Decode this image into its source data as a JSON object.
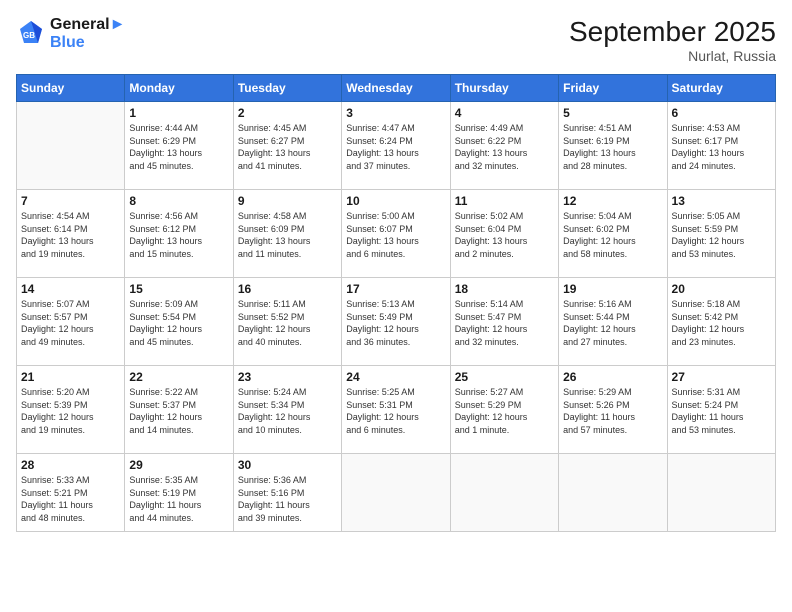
{
  "header": {
    "logo_line1": "General",
    "logo_line2": "Blue",
    "month": "September 2025",
    "location": "Nurlat, Russia"
  },
  "weekdays": [
    "Sunday",
    "Monday",
    "Tuesday",
    "Wednesday",
    "Thursday",
    "Friday",
    "Saturday"
  ],
  "weeks": [
    [
      {
        "day": "",
        "info": ""
      },
      {
        "day": "1",
        "info": "Sunrise: 4:44 AM\nSunset: 6:29 PM\nDaylight: 13 hours\nand 45 minutes."
      },
      {
        "day": "2",
        "info": "Sunrise: 4:45 AM\nSunset: 6:27 PM\nDaylight: 13 hours\nand 41 minutes."
      },
      {
        "day": "3",
        "info": "Sunrise: 4:47 AM\nSunset: 6:24 PM\nDaylight: 13 hours\nand 37 minutes."
      },
      {
        "day": "4",
        "info": "Sunrise: 4:49 AM\nSunset: 6:22 PM\nDaylight: 13 hours\nand 32 minutes."
      },
      {
        "day": "5",
        "info": "Sunrise: 4:51 AM\nSunset: 6:19 PM\nDaylight: 13 hours\nand 28 minutes."
      },
      {
        "day": "6",
        "info": "Sunrise: 4:53 AM\nSunset: 6:17 PM\nDaylight: 13 hours\nand 24 minutes."
      }
    ],
    [
      {
        "day": "7",
        "info": "Sunrise: 4:54 AM\nSunset: 6:14 PM\nDaylight: 13 hours\nand 19 minutes."
      },
      {
        "day": "8",
        "info": "Sunrise: 4:56 AM\nSunset: 6:12 PM\nDaylight: 13 hours\nand 15 minutes."
      },
      {
        "day": "9",
        "info": "Sunrise: 4:58 AM\nSunset: 6:09 PM\nDaylight: 13 hours\nand 11 minutes."
      },
      {
        "day": "10",
        "info": "Sunrise: 5:00 AM\nSunset: 6:07 PM\nDaylight: 13 hours\nand 6 minutes."
      },
      {
        "day": "11",
        "info": "Sunrise: 5:02 AM\nSunset: 6:04 PM\nDaylight: 13 hours\nand 2 minutes."
      },
      {
        "day": "12",
        "info": "Sunrise: 5:04 AM\nSunset: 6:02 PM\nDaylight: 12 hours\nand 58 minutes."
      },
      {
        "day": "13",
        "info": "Sunrise: 5:05 AM\nSunset: 5:59 PM\nDaylight: 12 hours\nand 53 minutes."
      }
    ],
    [
      {
        "day": "14",
        "info": "Sunrise: 5:07 AM\nSunset: 5:57 PM\nDaylight: 12 hours\nand 49 minutes."
      },
      {
        "day": "15",
        "info": "Sunrise: 5:09 AM\nSunset: 5:54 PM\nDaylight: 12 hours\nand 45 minutes."
      },
      {
        "day": "16",
        "info": "Sunrise: 5:11 AM\nSunset: 5:52 PM\nDaylight: 12 hours\nand 40 minutes."
      },
      {
        "day": "17",
        "info": "Sunrise: 5:13 AM\nSunset: 5:49 PM\nDaylight: 12 hours\nand 36 minutes."
      },
      {
        "day": "18",
        "info": "Sunrise: 5:14 AM\nSunset: 5:47 PM\nDaylight: 12 hours\nand 32 minutes."
      },
      {
        "day": "19",
        "info": "Sunrise: 5:16 AM\nSunset: 5:44 PM\nDaylight: 12 hours\nand 27 minutes."
      },
      {
        "day": "20",
        "info": "Sunrise: 5:18 AM\nSunset: 5:42 PM\nDaylight: 12 hours\nand 23 minutes."
      }
    ],
    [
      {
        "day": "21",
        "info": "Sunrise: 5:20 AM\nSunset: 5:39 PM\nDaylight: 12 hours\nand 19 minutes."
      },
      {
        "day": "22",
        "info": "Sunrise: 5:22 AM\nSunset: 5:37 PM\nDaylight: 12 hours\nand 14 minutes."
      },
      {
        "day": "23",
        "info": "Sunrise: 5:24 AM\nSunset: 5:34 PM\nDaylight: 12 hours\nand 10 minutes."
      },
      {
        "day": "24",
        "info": "Sunrise: 5:25 AM\nSunset: 5:31 PM\nDaylight: 12 hours\nand 6 minutes."
      },
      {
        "day": "25",
        "info": "Sunrise: 5:27 AM\nSunset: 5:29 PM\nDaylight: 12 hours\nand 1 minute."
      },
      {
        "day": "26",
        "info": "Sunrise: 5:29 AM\nSunset: 5:26 PM\nDaylight: 11 hours\nand 57 minutes."
      },
      {
        "day": "27",
        "info": "Sunrise: 5:31 AM\nSunset: 5:24 PM\nDaylight: 11 hours\nand 53 minutes."
      }
    ],
    [
      {
        "day": "28",
        "info": "Sunrise: 5:33 AM\nSunset: 5:21 PM\nDaylight: 11 hours\nand 48 minutes."
      },
      {
        "day": "29",
        "info": "Sunrise: 5:35 AM\nSunset: 5:19 PM\nDaylight: 11 hours\nand 44 minutes."
      },
      {
        "day": "30",
        "info": "Sunrise: 5:36 AM\nSunset: 5:16 PM\nDaylight: 11 hours\nand 39 minutes."
      },
      {
        "day": "",
        "info": ""
      },
      {
        "day": "",
        "info": ""
      },
      {
        "day": "",
        "info": ""
      },
      {
        "day": "",
        "info": ""
      }
    ]
  ]
}
